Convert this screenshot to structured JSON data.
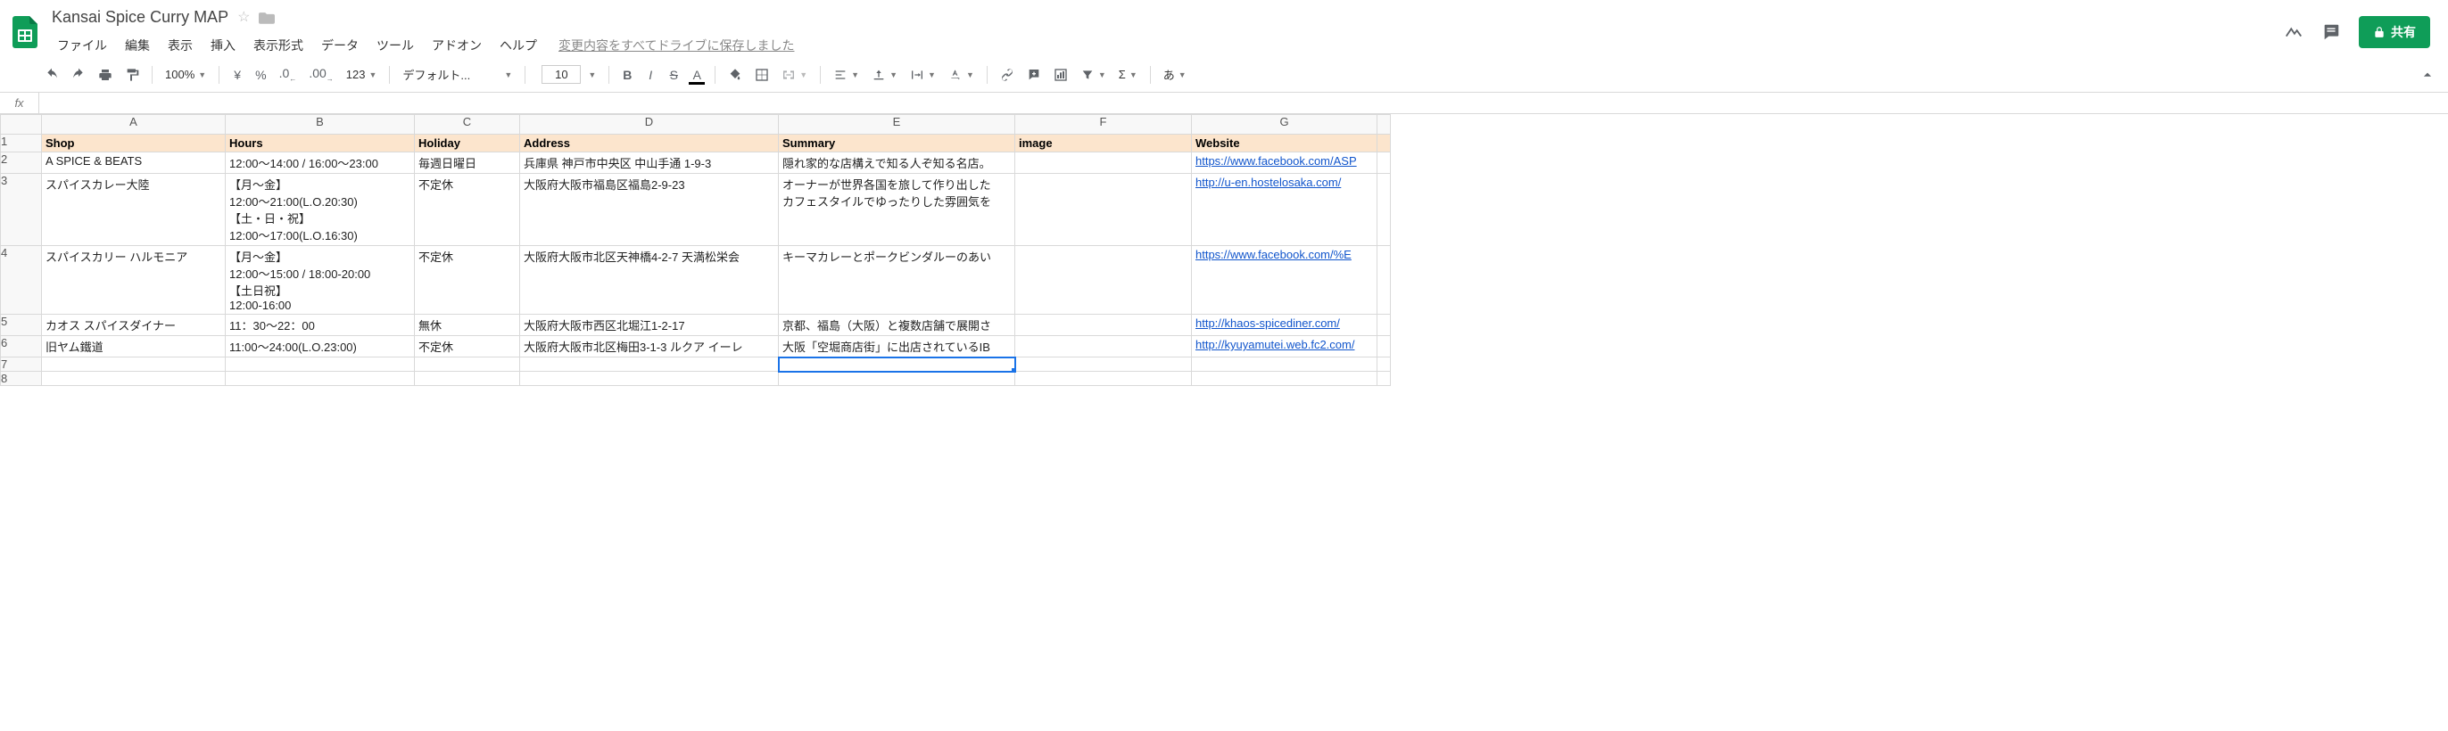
{
  "doc_title": "Kansai Spice Curry MAP",
  "save_status": "変更内容をすべてドライブに保存しました",
  "menu": [
    "ファイル",
    "編集",
    "表示",
    "挿入",
    "表示形式",
    "データ",
    "ツール",
    "アドオン",
    "ヘルプ"
  ],
  "share_label": "共有",
  "toolbar": {
    "zoom": "100%",
    "currency": "¥",
    "percent": "%",
    "dec_dec": ".0",
    "inc_dec": ".00",
    "more_fmt": "123",
    "font": "デフォルト...",
    "size": "10",
    "spell": "あ"
  },
  "fx_label": "fx",
  "columns": [
    "A",
    "B",
    "C",
    "D",
    "E",
    "F",
    "G",
    ""
  ],
  "row_numbers": [
    "1",
    "2",
    "3",
    "4",
    "5",
    "6",
    "7",
    "8"
  ],
  "header_row": [
    "Shop",
    "Hours",
    "Holiday",
    "Address",
    "Summary",
    "image",
    "Website"
  ],
  "rows": [
    {
      "shop": "A SPICE & BEATS",
      "hours": "12:00〜14:00 / 16:00〜23:00",
      "holiday": "毎週日曜日",
      "address": "兵庫県 神戸市中央区 中山手通 1-9-3",
      "summary": "隠れ家的な店構えで知る人ぞ知る名店。",
      "image": "",
      "website": "https://www.facebook.com/ASP"
    },
    {
      "shop": "スパイスカレー大陸",
      "hours": "【月〜金】\n12:00〜21:00(L.O.20:30)\n【土・日・祝】\n12:00〜17:00(L.O.16:30)",
      "holiday": "不定休",
      "address": "大阪府大阪市福島区福島2-9-23",
      "summary": "オーナーが世界各国を旅して作り出した\nカフェスタイルでゆったりした雰囲気を",
      "image": "",
      "website": "http://u-en.hostelosaka.com/"
    },
    {
      "shop": "スパイスカリー ハルモニア",
      "hours": "【月〜金】\n12:00〜15:00 / 18:00-20:00\n【土日祝】\n12:00-16:00",
      "holiday": "不定休",
      "address": "大阪府大阪市北区天神橋4-2-7 天満松栄会",
      "summary": "キーマカレーとポークビンダルーのあい",
      "image": "",
      "website": "https://www.facebook.com/%E"
    },
    {
      "shop": "カオス スパイスダイナー",
      "hours": "11：30～22：00",
      "holiday": "無休",
      "address": "大阪府大阪市西区北堀江1-2-17",
      "summary": "京都、福島（大阪）と複数店舗で展開さ",
      "image": "",
      "website": "http://khaos-spicediner.com/"
    },
    {
      "shop": "旧ヤム鐵道",
      "hours": "11:00〜24:00(L.O.23:00)",
      "holiday": "不定休",
      "address": "大阪府大阪市北区梅田3-1-3 ルクア イーレ",
      "summary": "大阪「空堀商店街」に出店されているIB",
      "image": "",
      "website": "http://kyuyamutei.web.fc2.com/"
    }
  ],
  "selected_cell": {
    "row": 7,
    "col": "E"
  }
}
